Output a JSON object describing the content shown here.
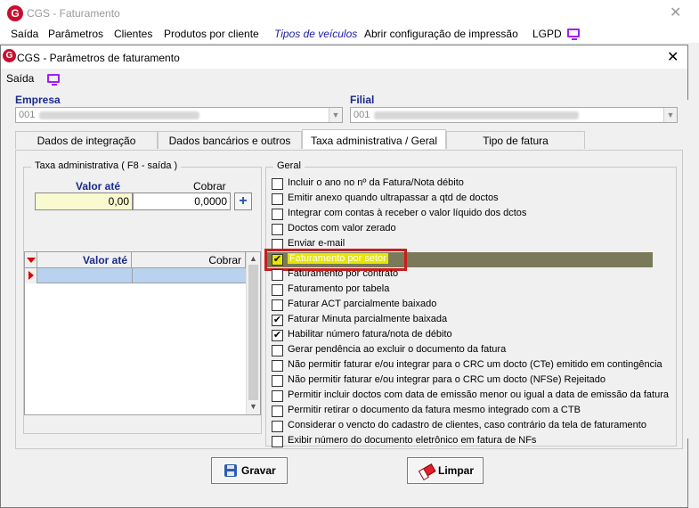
{
  "main_window": {
    "title": "CGS - Faturamento",
    "menu": [
      "Saída",
      "Parâmetros",
      "Clientes",
      "Produtos por cliente",
      "Tipos de veículos",
      "Abrir configuração de impressão",
      "LGPD"
    ]
  },
  "dialog": {
    "title": "CGS - Parâmetros de faturamento",
    "menu_saida": "Saída",
    "empresa": {
      "label": "Empresa",
      "value": "001"
    },
    "filial": {
      "label": "Filial",
      "value": "001"
    },
    "tabs": [
      "Dados de integração",
      "Dados bancários e outros",
      "Taxa administrativa / Geral",
      "Tipo de fatura"
    ],
    "active_tab": 2,
    "taxa": {
      "legend": "Taxa administrativa ( F8 - saída )",
      "valor_ate_label": "Valor até",
      "cobrar_label": "Cobrar",
      "valor_ate_value": "0,00",
      "cobrar_value": "0,0000",
      "grid_columns": [
        "Valor até",
        "Cobrar"
      ]
    },
    "geral": {
      "legend": "Geral",
      "options": [
        {
          "label": "Incluir o ano no nº da Fatura/Nota débito",
          "checked": false
        },
        {
          "label": "Emitir anexo quando ultrapassar a qtd de doctos",
          "checked": false
        },
        {
          "label": "Integrar com contas à receber o valor líquido dos dctos",
          "checked": false
        },
        {
          "label": "Doctos com valor zerado",
          "checked": false
        },
        {
          "label": "Enviar e-mail",
          "checked": false
        },
        {
          "label": "Faturamento por setor",
          "checked": true,
          "selected": true
        },
        {
          "label": "Faturamento por contrato",
          "checked": false
        },
        {
          "label": "Faturamento por tabela",
          "checked": false
        },
        {
          "label": "Faturar ACT parcialmente baixado",
          "checked": false
        },
        {
          "label": "Faturar Minuta parcialmente baixada",
          "checked": true
        },
        {
          "label": "Habilitar número fatura/nota de débito",
          "checked": true
        },
        {
          "label": "Gerar pendência ao excluir o documento da fatura",
          "checked": false
        },
        {
          "label": "Não permitir faturar e/ou integrar para o CRC um docto (CTe) emitido em contingência",
          "checked": false
        },
        {
          "label": "Não permitir faturar e/ou integrar para o CRC um docto (NFSe) Rejeitado",
          "checked": false
        },
        {
          "label": "Permitir incluir doctos com data de emissão menor ou igual a data de emissão da fatura",
          "checked": false
        },
        {
          "label": "Permitir retirar o documento da fatura mesmo integrado com a CTB",
          "checked": false
        },
        {
          "label": "Considerar o vencto do cadastro de clientes, caso contrário da tela de faturamento",
          "checked": false
        },
        {
          "label": "Exibir número do documento eletrônico em fatura de NFs",
          "checked": false
        }
      ]
    },
    "buttons": {
      "gravar": "Gravar",
      "limpar": "Limpar"
    }
  },
  "colors": {
    "selection": "#7a7a5a",
    "highlight_border": "#c81e1e",
    "highlight_fill": "#e6e600",
    "accent_red": "#e00000"
  }
}
